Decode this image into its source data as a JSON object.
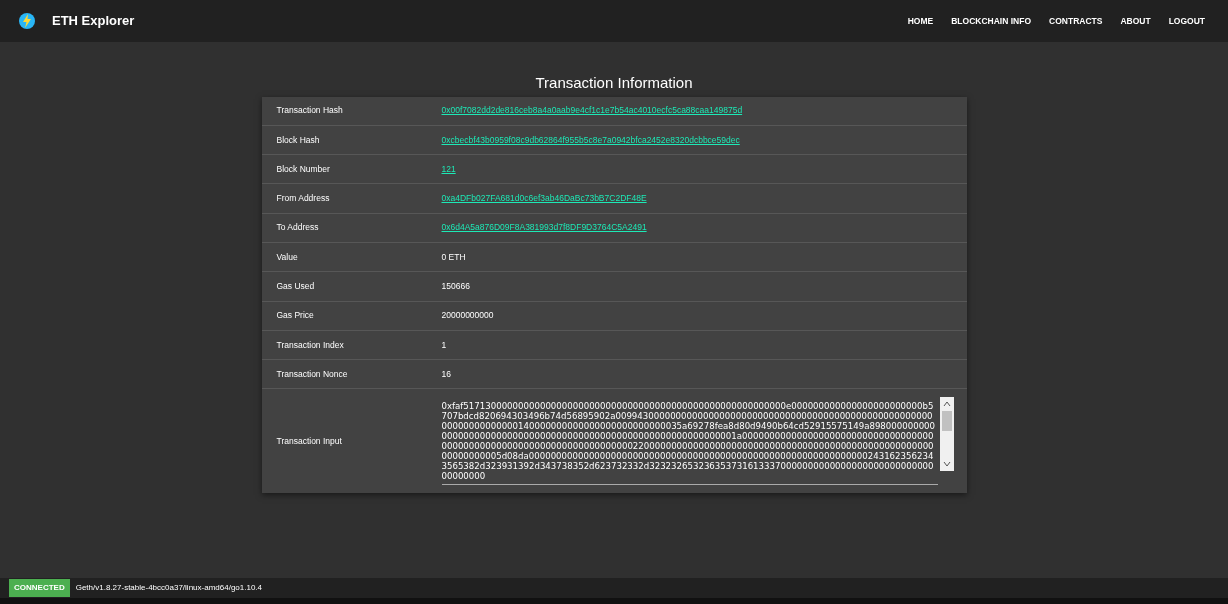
{
  "navbar": {
    "brand": "ETH Explorer",
    "links": [
      {
        "label": "HOME"
      },
      {
        "label": "BLOCKCHAIN INFO"
      },
      {
        "label": "CONTRACTS"
      },
      {
        "label": "ABOUT"
      },
      {
        "label": "LOGOUT"
      }
    ]
  },
  "title": "Transaction Information",
  "rows": [
    {
      "label": "Transaction Hash",
      "value": "0x00f7082dd2de816ceb8a4a0aab9e4cf1c1e7b54ac4010ecfc5ca88caa149875d",
      "kind": "link"
    },
    {
      "label": "Block Hash",
      "value": "0xcbecbf43b0959f08c9db62864f955b5c8e7a0942bfca2452e8320dcbbce59dec",
      "kind": "link"
    },
    {
      "label": "Block Number",
      "value": "121",
      "kind": "link"
    },
    {
      "label": "From Address",
      "value": "0xa4DFb027FA681d0c6ef3ab46DaBc73bB7C2DF48E",
      "kind": "link"
    },
    {
      "label": "To Address",
      "value": "0x6d4A5a876D09F8A381993d7f8DF9D3764C5A2491",
      "kind": "link"
    },
    {
      "label": "Value",
      "value": "0 ETH",
      "kind": "text"
    },
    {
      "label": "Gas Used",
      "value": "150666",
      "kind": "text"
    },
    {
      "label": "Gas Price",
      "value": "20000000000",
      "kind": "text"
    },
    {
      "label": "Transaction Index",
      "value": "1",
      "kind": "text"
    },
    {
      "label": "Transaction Nonce",
      "value": "16",
      "kind": "text"
    },
    {
      "label": "Transaction Input",
      "value": "0xfaf51713000000000000000000000000000000000000000000000000000000e000000000000000000000000b5707bdcd820694303496b74d56895902a009943000000000000000000000000000000000000000000000000000000000000000000140000000000000000000000000035a69278fea8d80d9490b64cd52915575149a898000000000000000000000000000000000000000000000000000000000000001a0000000000000000000000000000000000000000000000000000000000000000000000220000000000000000000000000000000000000000000000000000000000000005d08da000000000000000000000000000000000000000000000000000000000000002431623562343565382d323931392d343738352d623732332d323232653236353731613337000000000000000000000000000000000000",
      "kind": "textarea"
    }
  ],
  "status": {
    "badge": "CONNECTED",
    "version": "Geth/v1.8.27-stable-4bcc0a37/linux-amd64/go1.10.4"
  }
}
